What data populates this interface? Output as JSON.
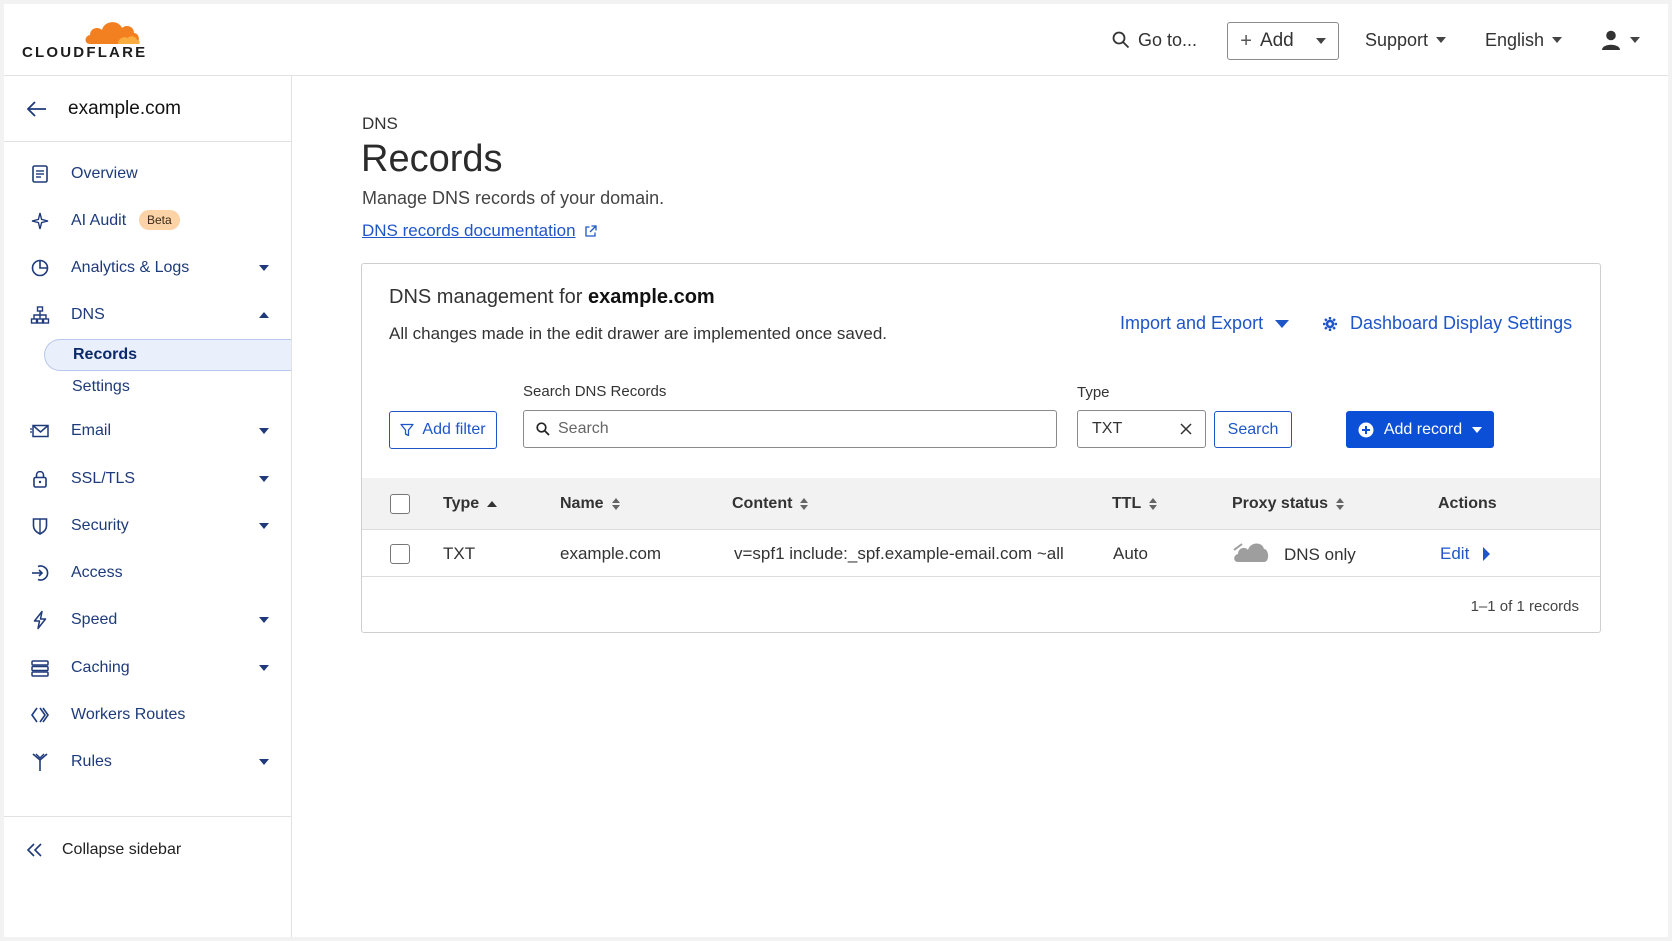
{
  "brand": {
    "logo_text": "CLOUDFLARE",
    "orange": "#f38020"
  },
  "topbar": {
    "goto_label": "Go to...",
    "add_label": "Add",
    "support_label": "Support",
    "language_label": "English"
  },
  "sidebar": {
    "zone": "example.com",
    "items": [
      {
        "label": "Overview",
        "icon": "document-icon"
      },
      {
        "label": "AI Audit",
        "icon": "sparkle-icon",
        "badge": "Beta"
      },
      {
        "label": "Analytics & Logs",
        "icon": "pie-chart-icon"
      },
      {
        "label": "DNS",
        "icon": "network-icon"
      },
      {
        "label": "Email",
        "icon": "envelope-icon"
      },
      {
        "label": "SSL/TLS",
        "icon": "lock-icon"
      },
      {
        "label": "Security",
        "icon": "shield-icon"
      },
      {
        "label": "Access",
        "icon": "sign-in-icon"
      },
      {
        "label": "Speed",
        "icon": "lightning-icon"
      },
      {
        "label": "Caching",
        "icon": "server-stack-icon"
      },
      {
        "label": "Workers Routes",
        "icon": "diamond-code-icon"
      },
      {
        "label": "Rules",
        "icon": "fork-icon"
      }
    ],
    "dns_sub": [
      {
        "label": "Records",
        "active": true
      },
      {
        "label": "Settings",
        "active": false
      }
    ],
    "collapse_label": "Collapse sidebar"
  },
  "page": {
    "breadcrumb": "DNS",
    "title": "Records",
    "description": "Manage DNS records of your domain.",
    "doc_link": "DNS records documentation"
  },
  "card": {
    "title_prefix": "DNS management for ",
    "title_domain": "example.com",
    "subtitle": "All changes made in the edit drawer are implemented once saved.",
    "import_export": "Import and Export",
    "display_settings": "Dashboard Display Settings",
    "add_filter": "Add filter",
    "search_label": "Search DNS Records",
    "search_placeholder": "Search",
    "type_label": "Type",
    "type_value": "TXT",
    "search_button": "Search",
    "add_record": "Add record",
    "columns": [
      "Type",
      "Name",
      "Content",
      "TTL",
      "Proxy status",
      "Actions"
    ],
    "rows": [
      {
        "type": "TXT",
        "name": "example.com",
        "content": "v=spf1 include:_spf.example-email.com ~all",
        "ttl": "Auto",
        "proxy": "DNS only",
        "action": "Edit"
      }
    ],
    "pager": "1–1 of 1 records"
  }
}
